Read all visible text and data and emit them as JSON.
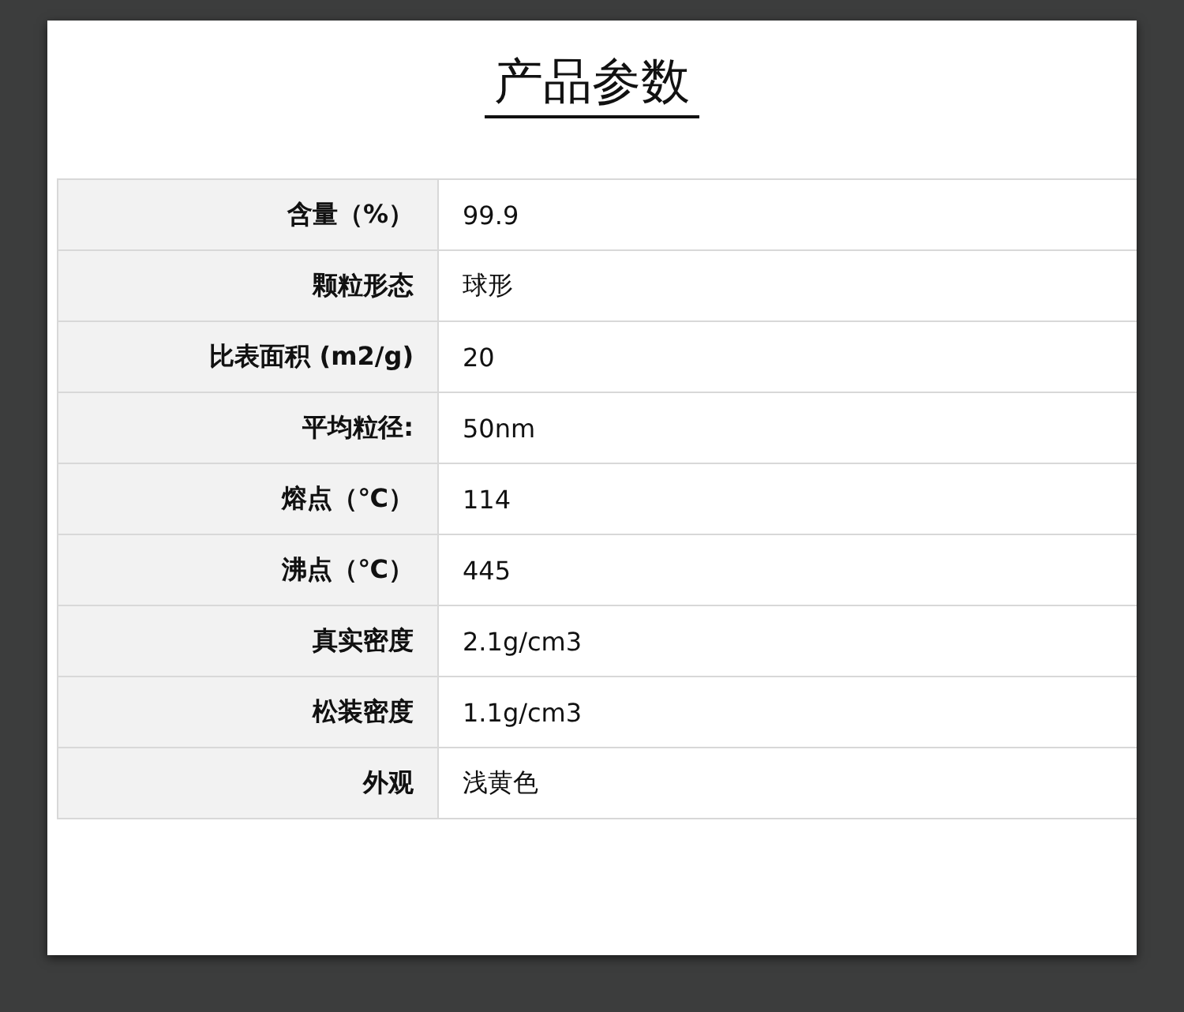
{
  "title": "产品参数",
  "rows": [
    {
      "label": "含量（%）",
      "value": "99.9"
    },
    {
      "label": "颗粒形态",
      "value": "球形"
    },
    {
      "label": "比表面积 (m2/g)",
      "value": "20"
    },
    {
      "label": "平均粒径:",
      "value": "50nm"
    },
    {
      "label": "熔点（℃）",
      "value": "114"
    },
    {
      "label": "沸点（℃）",
      "value": "445"
    },
    {
      "label": "真实密度",
      "value": "2.1g/cm3"
    },
    {
      "label": "松装密度",
      "value": "1.1g/cm3"
    },
    {
      "label": "外观",
      "value": "浅黄色"
    }
  ]
}
